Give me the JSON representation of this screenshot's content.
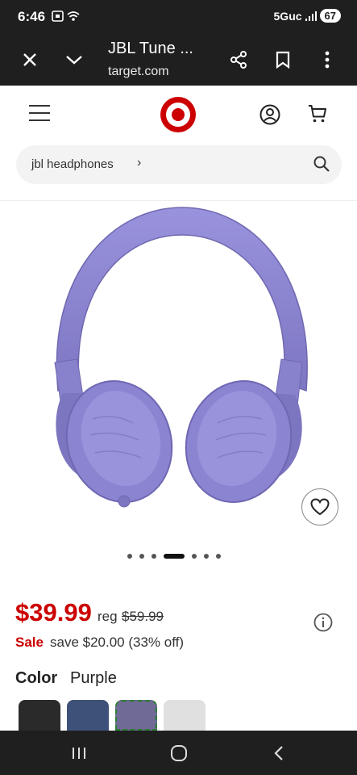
{
  "status": {
    "time": "6:46",
    "network": "5Guc",
    "battery": "67"
  },
  "browser": {
    "title": "JBL Tune ...",
    "url": "target.com"
  },
  "search": {
    "query": "jbl headphones",
    "chevron": "›"
  },
  "product": {
    "name": "JBL Tune headphones",
    "image_color": "#8d86d0",
    "carousel_total": 7,
    "carousel_active": 4
  },
  "pricing": {
    "price": "$39.99",
    "reg_label": "reg",
    "reg_price": "$59.99",
    "sale_label": "Sale",
    "save_text": "save $20.00 (33% off)"
  },
  "color": {
    "label": "Color",
    "selected": "Purple",
    "swatches": [
      {
        "name": "Black",
        "hex": "#2a2a2a"
      },
      {
        "name": "Blue",
        "hex": "#3e5279"
      },
      {
        "name": "Purple",
        "hex": "#6f6a96"
      },
      {
        "name": "White",
        "hex": "#e0e0e0"
      }
    ]
  },
  "colors": {
    "brand_red": "#cc0000",
    "chrome_dark": "#1f1f1f"
  }
}
